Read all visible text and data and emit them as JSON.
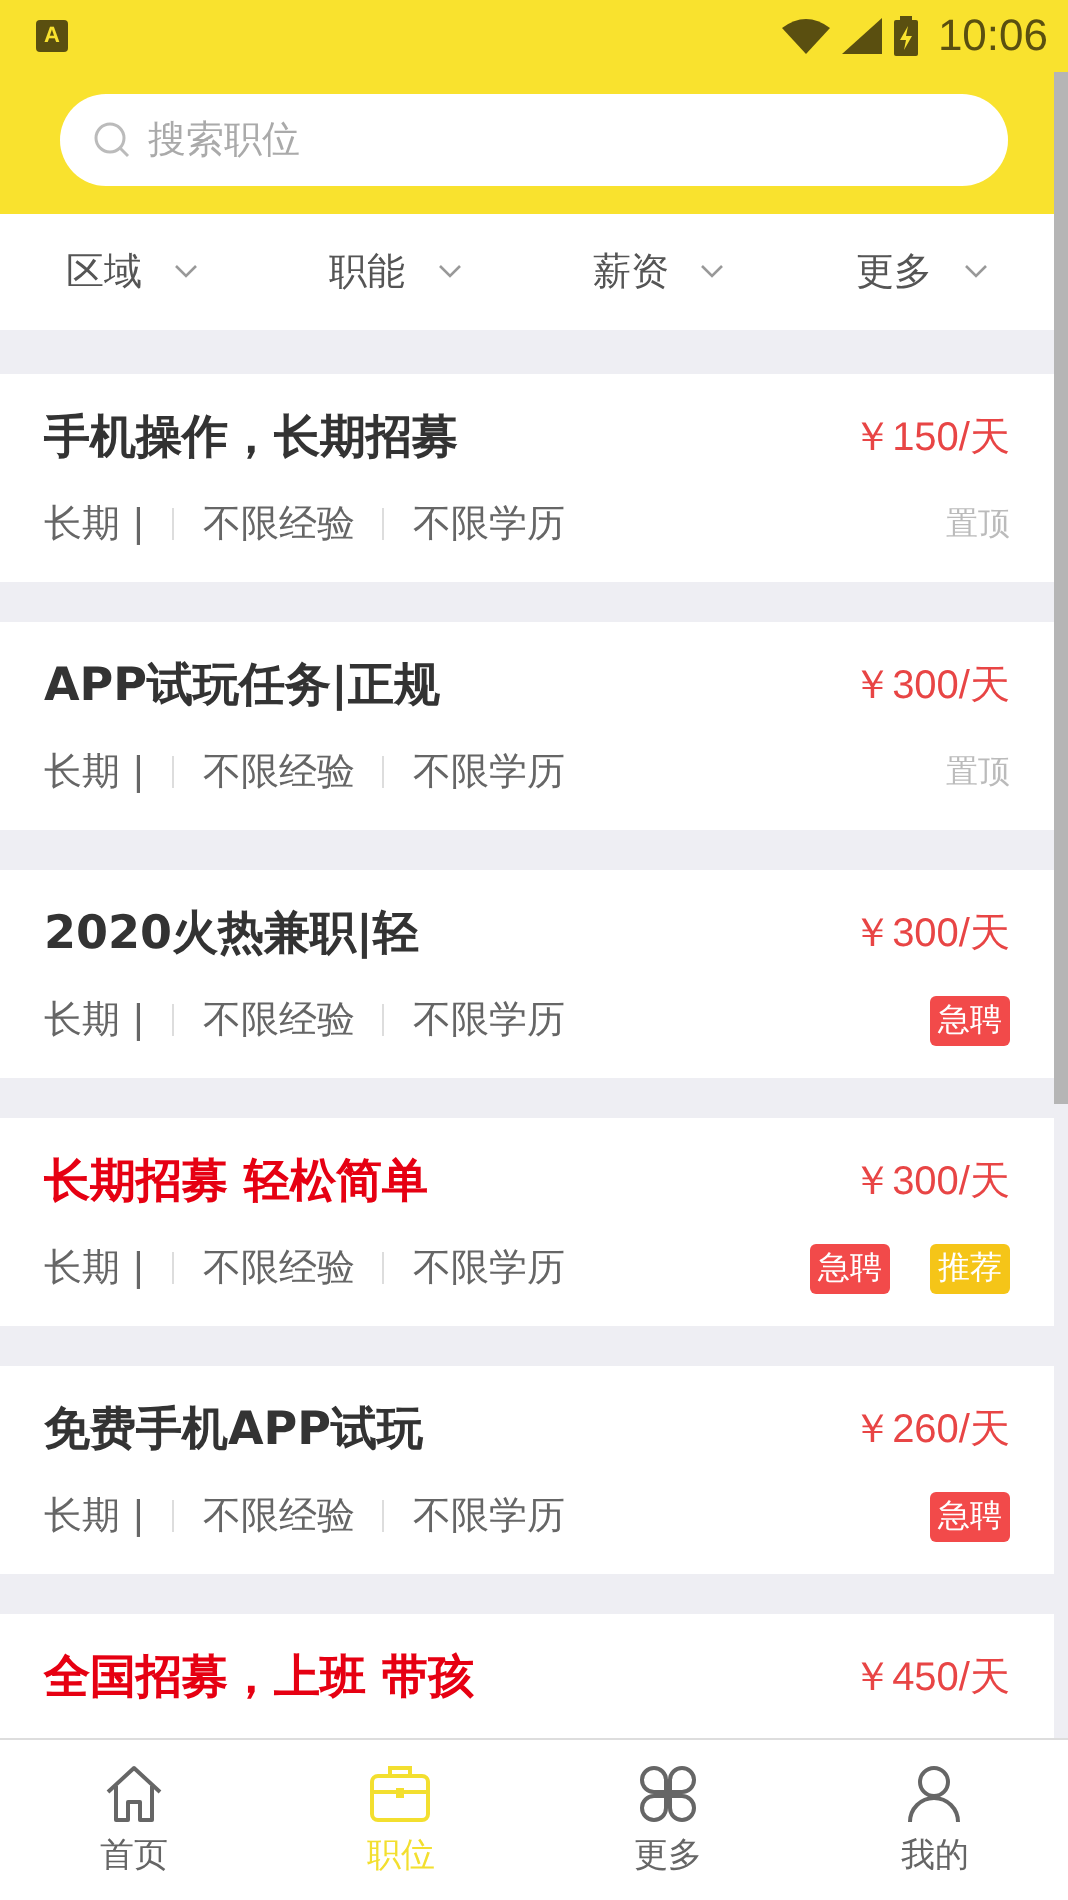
{
  "status_bar": {
    "app_badge": "A",
    "time": "10:06"
  },
  "search": {
    "placeholder": "搜索职位"
  },
  "filters": [
    {
      "label": "区域"
    },
    {
      "label": "职能"
    },
    {
      "label": "薪资"
    },
    {
      "label": "更多"
    }
  ],
  "jobs": [
    {
      "title": "手机操作，长期招募",
      "highlight": false,
      "salary": "￥150/天",
      "meta": [
        "长期 |",
        "不限经验",
        "不限学历"
      ],
      "tags": [
        {
          "kind": "top",
          "label": "置顶"
        }
      ]
    },
    {
      "title": "APP试玩任务|正规",
      "highlight": false,
      "salary": "￥300/天",
      "meta": [
        "长期 |",
        "不限经验",
        "不限学历"
      ],
      "tags": [
        {
          "kind": "top",
          "label": "置顶"
        }
      ]
    },
    {
      "title": "2020火热兼职|轻",
      "highlight": false,
      "salary": "￥300/天",
      "meta": [
        "长期 |",
        "不限经验",
        "不限学历"
      ],
      "tags": [
        {
          "kind": "urgent",
          "label": "急聘"
        }
      ]
    },
    {
      "title": "长期招募 轻松简单",
      "highlight": true,
      "salary": "￥300/天",
      "meta": [
        "长期 |",
        "不限经验",
        "不限学历"
      ],
      "tags": [
        {
          "kind": "urgent",
          "label": "急聘"
        },
        {
          "kind": "recommend",
          "label": "推荐"
        }
      ]
    },
    {
      "title": "免费手机APP试玩",
      "highlight": false,
      "salary": "￥260/天",
      "meta": [
        "长期 |",
        "不限经验",
        "不限学历"
      ],
      "tags": [
        {
          "kind": "urgent",
          "label": "急聘"
        }
      ]
    },
    {
      "title": "全国招募，上班 带孩",
      "highlight": true,
      "salary": "￥450/天"
    }
  ],
  "tabs": [
    {
      "label": "首页",
      "selected": false
    },
    {
      "label": "职位",
      "selected": true
    },
    {
      "label": "更多",
      "selected": false
    },
    {
      "label": "我的",
      "selected": false
    }
  ]
}
